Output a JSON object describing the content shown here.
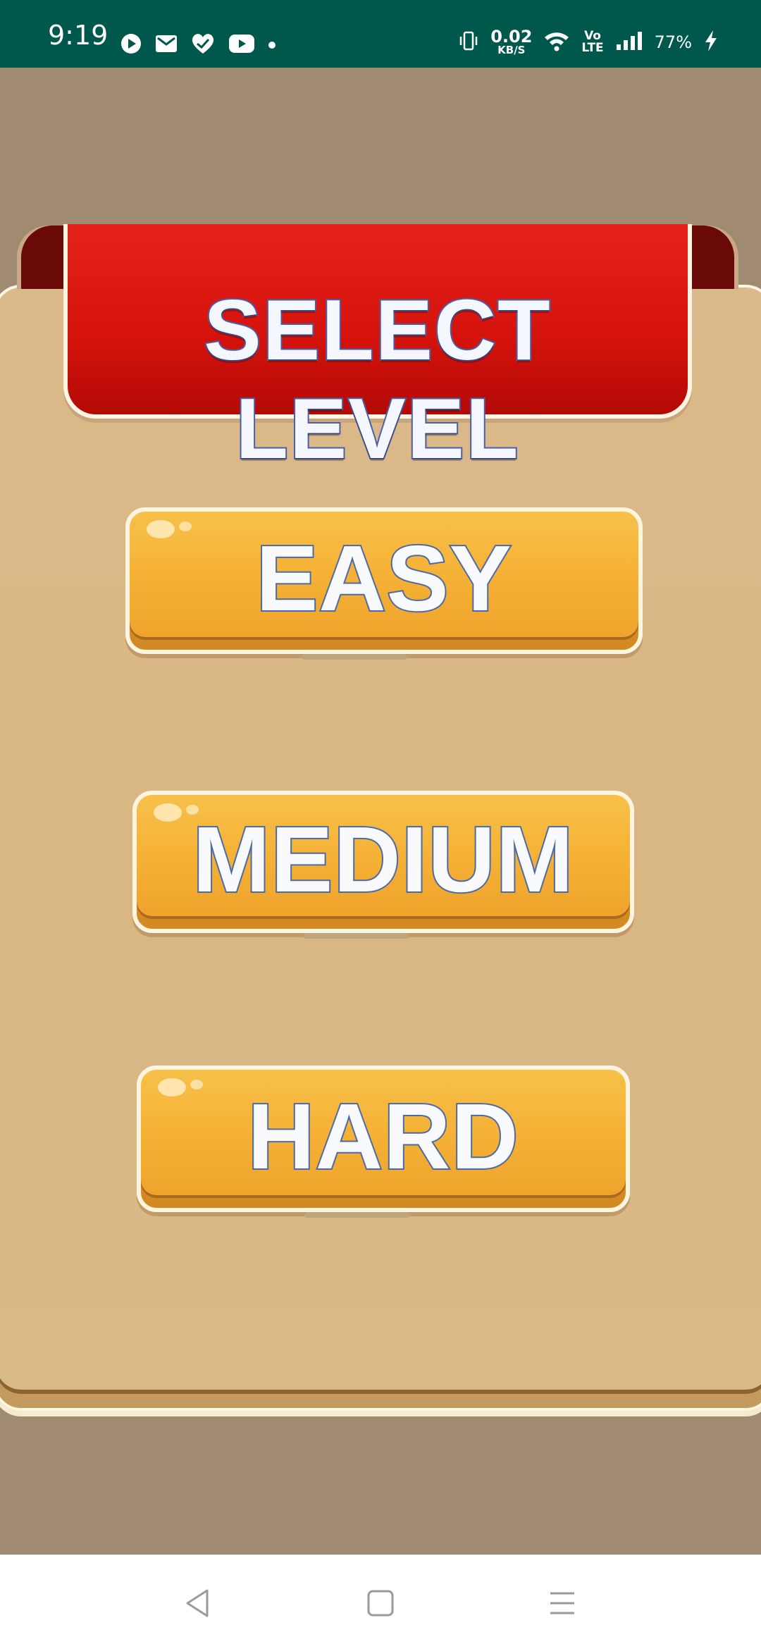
{
  "status_bar": {
    "time": "9:19",
    "left_icons": [
      "play-icon",
      "gmail-icon",
      "heart-check-icon",
      "youtube-icon",
      "dot-icon"
    ],
    "network_speed_value": "0.02",
    "network_speed_unit": "KB/S",
    "volte_top": "Vo",
    "volte_bottom": "LTE",
    "battery_percent": "77%",
    "right_icons": [
      "vibrate-icon",
      "wifi-icon",
      "signal-icon",
      "charging-icon"
    ]
  },
  "screen": {
    "title": "SELECT LEVEL",
    "levels": [
      {
        "label": "EASY"
      },
      {
        "label": "MEDIUM"
      },
      {
        "label": "HARD"
      }
    ]
  },
  "nav_bar": {
    "buttons": [
      "back-icon",
      "home-icon",
      "menu-icon"
    ]
  },
  "colors": {
    "status_bar": "#00574b",
    "background": "#a08a72",
    "board": "#d8b783",
    "banner": "#d5120c",
    "button": "#f5b236",
    "text_outline": "#4a5fa8"
  }
}
